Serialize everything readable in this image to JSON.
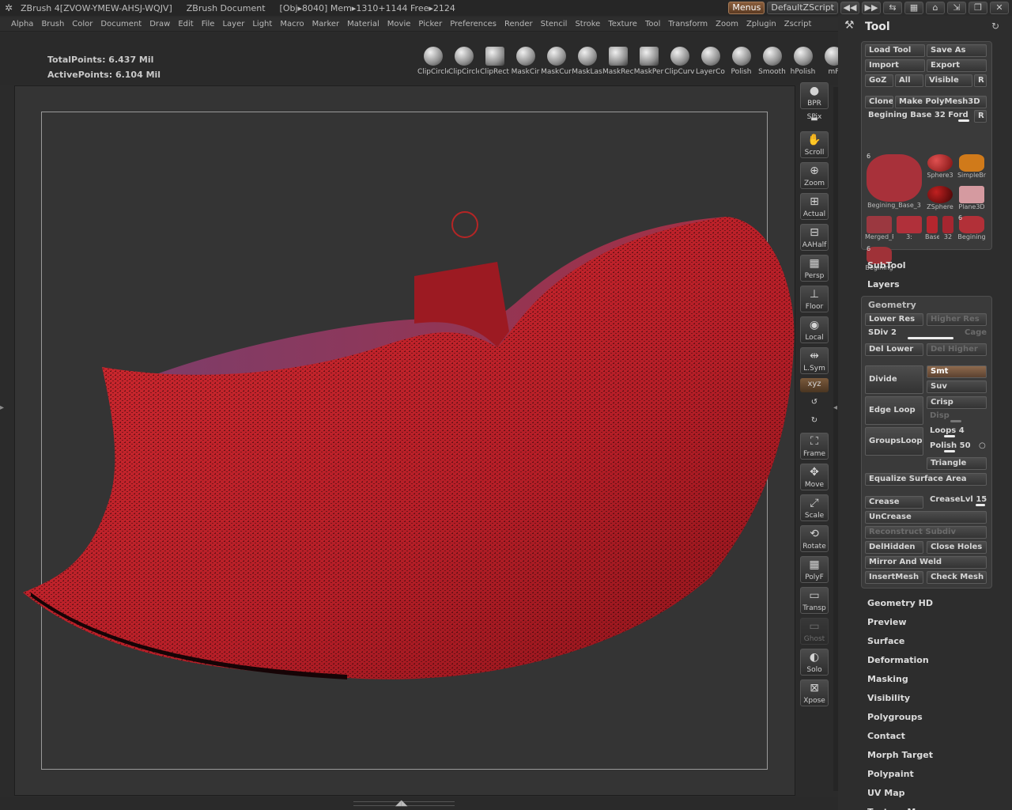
{
  "titlebar": {
    "app_name": "ZBrush 4[ZVOW-YMEW-AHSJ-WQJV]",
    "document": "ZBrush Document",
    "status": "[Obj▸8040] Mem▸1310+1144 Free▸2124",
    "menus_label": "Menus",
    "script_label": "DefaultZScript"
  },
  "menubar": [
    "Alpha",
    "Brush",
    "Color",
    "Document",
    "Draw",
    "Edit",
    "File",
    "Layer",
    "Light",
    "Macro",
    "Marker",
    "Material",
    "Movie",
    "Picker",
    "Preferences",
    "Render",
    "Stencil",
    "Stroke",
    "Texture",
    "Tool",
    "Transform",
    "Zoom",
    "Zplugin",
    "Zscript"
  ],
  "info": {
    "total_points": "TotalPoints: 6.437 Mil",
    "active_points": "ActivePoints: 6.104 Mil"
  },
  "shelf": [
    "ClipCircle",
    "ClipCircle",
    "ClipRect",
    "MaskCir",
    "MaskCur",
    "MaskLas",
    "MaskRec",
    "MaskPer",
    "ClipCurv",
    "LayerCo",
    "Polish",
    "Smooth",
    "hPolish",
    "mF"
  ],
  "vtools": [
    {
      "label": "BPR",
      "icon": "bpr-sphere-icon"
    },
    {
      "label": "SPix",
      "icon": "spix-slider-icon"
    },
    {
      "label": "Scroll",
      "icon": "scroll-hand-icon"
    },
    {
      "label": "Zoom",
      "icon": "zoom-icon"
    },
    {
      "label": "Actual",
      "icon": "actual-zoom-icon"
    },
    {
      "label": "AAHalf",
      "icon": "aahalf-icon"
    },
    {
      "label": "Persp",
      "icon": "perspective-grid-icon"
    },
    {
      "label": "Floor",
      "icon": "floor-icon"
    },
    {
      "label": "Local",
      "icon": "local-icon"
    },
    {
      "label": "L.Sym",
      "icon": "local-symmetry-icon"
    },
    {
      "label": "XYZ",
      "icon": "xyz-icon"
    },
    {
      "label": "",
      "icon": "rotate-y-icon"
    },
    {
      "label": "",
      "icon": "rotate-z-icon"
    },
    {
      "label": "Frame",
      "icon": "frame-icon"
    },
    {
      "label": "Move",
      "icon": "move-icon"
    },
    {
      "label": "Scale",
      "icon": "scale-icon"
    },
    {
      "label": "Rotate",
      "icon": "rotate-icon"
    },
    {
      "label": "PolyF",
      "icon": "polyframe-icon"
    },
    {
      "label": "Transp",
      "icon": "transparent-icon"
    },
    {
      "label": "Ghost",
      "icon": "ghost-icon"
    },
    {
      "label": "Solo",
      "icon": "solo-icon"
    },
    {
      "label": "Xpose",
      "icon": "xpose-icon"
    }
  ],
  "tool": {
    "title": "Tool",
    "load_tool": "Load Tool",
    "save_as": "Save As",
    "import": "Import",
    "export": "Export",
    "goz": "GoZ",
    "all": "All",
    "visible": "Visible",
    "r": "R",
    "clone": "Clone",
    "make_polymesh": "Make PolyMesh3D",
    "current_tool": "Begining Base 32 Ford",
    "thumbs": [
      {
        "label": "Begining_Base_3",
        "count": "6"
      },
      {
        "label": "Sphere3",
        "count": ""
      },
      {
        "label": "SimpleBr",
        "count": ""
      },
      {
        "label": "ZSphere",
        "count": ""
      },
      {
        "label": "Plane3D",
        "count": ""
      },
      {
        "label": "Merged_Plane",
        "count": ""
      },
      {
        "label": "3:",
        "count": ""
      },
      {
        "label": "Base",
        "count": ""
      },
      {
        "label": "32",
        "count": ""
      },
      {
        "label": "Begining",
        "count": "6"
      },
      {
        "label": "Begining",
        "count": "6"
      }
    ],
    "subtool": "SubTool",
    "layers": "Layers",
    "geometry": {
      "title": "Geometry",
      "lower_res": "Lower Res",
      "higher_res": "Higher Res",
      "sdiv_label": "SDiv",
      "sdiv_value": "2",
      "sdiv_level": 0.6,
      "cage": "Cage",
      "del_lower": "Del Lower",
      "del_higher": "Del Higher",
      "divide": "Divide",
      "smt": "Smt",
      "suv": "Suv",
      "edge_loop": "Edge Loop",
      "crisp": "Crisp",
      "disp": "Disp",
      "groups_loops": "GroupsLoops",
      "loops_label": "Loops",
      "loops_value": "4",
      "polish_label": "Polish",
      "polish_value": "50",
      "triangle": "Triangle",
      "equalize": "Equalize Surface Area",
      "crease": "Crease",
      "crease_lvl_label": "CreaseLvl",
      "crease_lvl_value": "15",
      "uncrease": "UnCrease",
      "reconstruct": "Reconstruct Subdiv",
      "del_hidden": "DelHidden",
      "close_holes": "Close Holes",
      "mirror_weld": "Mirror And Weld",
      "insert_mesh": "InsertMesh",
      "check_mesh": "Check Mesh"
    },
    "sections": [
      "Geometry HD",
      "Preview",
      "Surface",
      "Deformation",
      "Masking",
      "Visibility",
      "Polygroups",
      "Contact",
      "Morph Target",
      "Polypaint",
      "UV Map",
      "Texture Map"
    ]
  },
  "colors": {
    "model_red": "#b5202a",
    "model_purple": "#6e3a66",
    "accent_orange": "#8e6a4e",
    "canvas_bg": "#343434"
  }
}
